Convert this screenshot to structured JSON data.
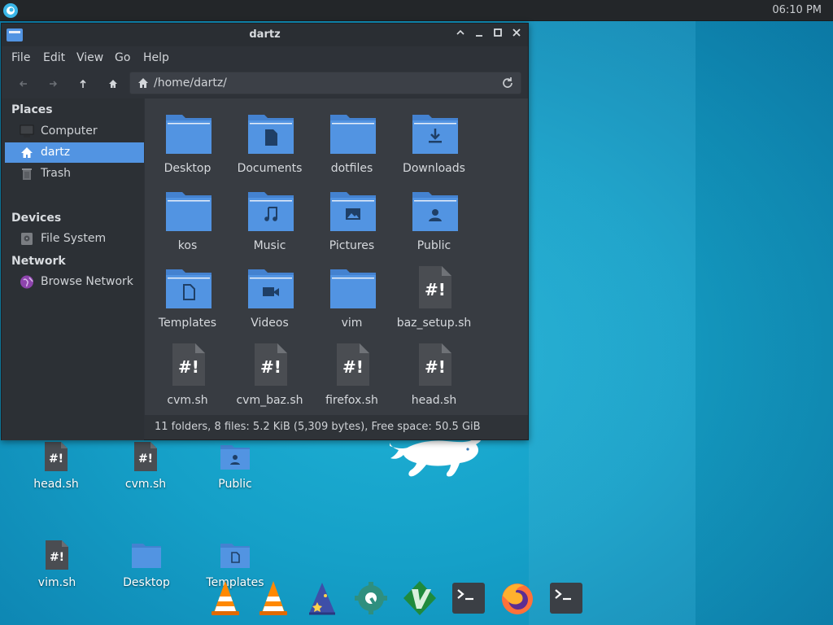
{
  "panel": {
    "clock": "06:10 PM"
  },
  "window": {
    "title": "dartz"
  },
  "menu": [
    "File",
    "Edit",
    "View",
    "Go",
    "Help"
  ],
  "path": "/home/dartz/",
  "sidebar": {
    "places_header": "Places",
    "places": [
      "Computer",
      "dartz",
      "Trash"
    ],
    "devices_header": "Devices",
    "devices": [
      "File System"
    ],
    "network_header": "Network",
    "network": [
      "Browse Network"
    ]
  },
  "files": [
    {
      "name": "Desktop",
      "type": "folder",
      "icon": "folder-icon"
    },
    {
      "name": "Documents",
      "type": "folder",
      "icon": "folder-documents-icon"
    },
    {
      "name": "dotfiles",
      "type": "folder",
      "icon": "folder-icon"
    },
    {
      "name": "Downloads",
      "type": "folder",
      "icon": "folder-download-icon"
    },
    {
      "name": "kos",
      "type": "folder",
      "icon": "folder-icon"
    },
    {
      "name": "Music",
      "type": "folder",
      "icon": "folder-music-icon"
    },
    {
      "name": "Pictures",
      "type": "folder",
      "icon": "folder-pictures-icon"
    },
    {
      "name": "Public",
      "type": "folder",
      "icon": "folder-public-icon"
    },
    {
      "name": "Templates",
      "type": "folder",
      "icon": "folder-templates-icon"
    },
    {
      "name": "Videos",
      "type": "folder",
      "icon": "folder-videos-icon"
    },
    {
      "name": "vim",
      "type": "folder",
      "icon": "folder-icon"
    },
    {
      "name": "baz_setup.sh",
      "type": "script",
      "icon": "script-icon"
    },
    {
      "name": "cvm.sh",
      "type": "script",
      "icon": "script-icon"
    },
    {
      "name": "cvm_baz.sh",
      "type": "script",
      "icon": "script-icon"
    },
    {
      "name": "firefox.sh",
      "type": "script",
      "icon": "script-icon"
    },
    {
      "name": "head.sh",
      "type": "script",
      "icon": "script-icon"
    }
  ],
  "status": "11 folders, 8 files: 5.2 KiB (5,309 bytes), Free space: 50.5 GiB",
  "desktop": [
    "head.sh",
    "cvm.sh",
    "Public",
    "vim.sh",
    "Desktop",
    "Templates"
  ],
  "dock": [
    "vlc-icon",
    "vlc-icon",
    "wizard-icon",
    "settings-icon",
    "vim-icon",
    "terminal-icon",
    "firefox-icon",
    "terminal-icon"
  ],
  "colors": {
    "accent": "#5294e2",
    "folder": "#5294e2",
    "window_bg": "#383c42",
    "sidebar_bg": "#2c3035"
  }
}
